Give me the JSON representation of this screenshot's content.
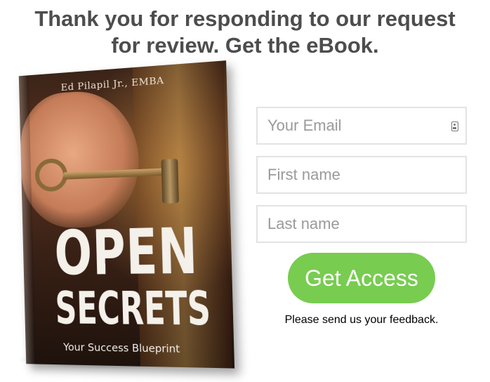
{
  "headline": {
    "line1": "Thank you for responding to our request",
    "line2": "for review. Get the eBook."
  },
  "book": {
    "author": "Ed Pilapil Jr., EMBA",
    "title_line1": "OPEN",
    "title_line2": "SECRETS",
    "subtitle": "Your Success Blueprint"
  },
  "form": {
    "email_placeholder": "Your Email",
    "first_name_placeholder": "First name",
    "last_name_placeholder": "Last name",
    "submit_label": "Get Access",
    "email_icon": "contact-card-icon"
  },
  "feedback_text": "Please send us your feedback.",
  "colors": {
    "headline": "#4d4d4d",
    "button": "#78cc50",
    "field_border": "#e3e3e3"
  }
}
